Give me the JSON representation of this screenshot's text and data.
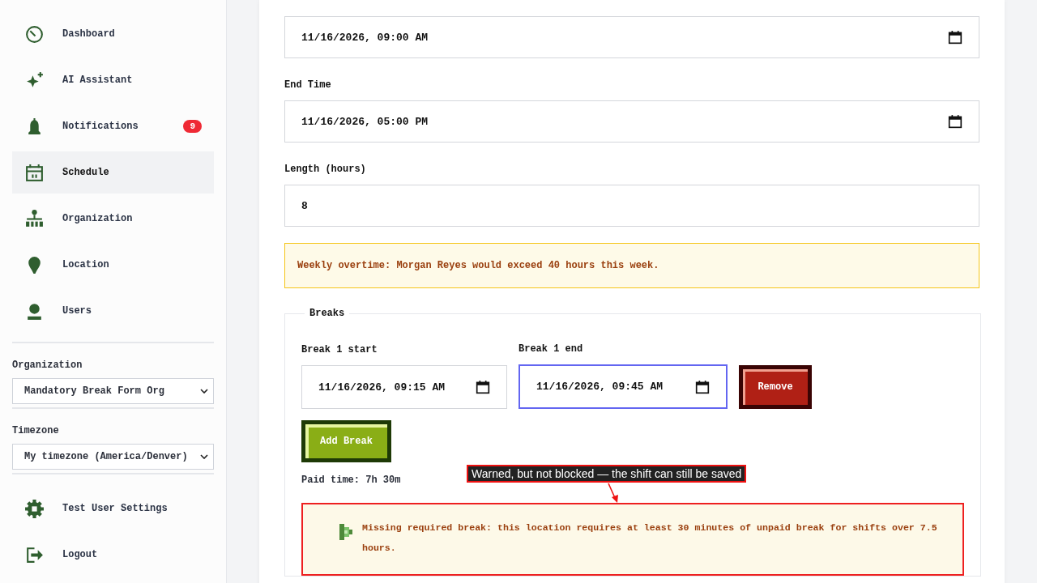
{
  "sidebar": {
    "items": [
      {
        "label": "Dashboard",
        "kind": "dashboard",
        "selected": false
      },
      {
        "label": "AI Assistant",
        "kind": "sparkle",
        "selected": false
      },
      {
        "label": "Notifications",
        "kind": "bell",
        "selected": false,
        "badge": "9"
      },
      {
        "label": "Schedule",
        "kind": "calendar",
        "selected": true
      },
      {
        "label": "Organization",
        "kind": "org",
        "selected": false
      },
      {
        "label": "Location",
        "kind": "pin",
        "selected": false
      },
      {
        "label": "Users",
        "kind": "user",
        "selected": false
      }
    ],
    "selects": [
      {
        "label": "Organization",
        "value": "Mandatory Break Form Org"
      },
      {
        "label": "Timezone",
        "value": "My timezone (America/Denver)"
      }
    ],
    "footer_items": [
      {
        "label": "Test User Settings",
        "kind": "gear"
      },
      {
        "label": "Logout",
        "kind": "logout"
      }
    ]
  },
  "form": {
    "start_time": {
      "value": "11/16/2026, 09:00 AM"
    },
    "end_time": {
      "label": "End Time",
      "value": "11/16/2026, 05:00 PM"
    },
    "length": {
      "label": "Length (hours)",
      "value": "8"
    },
    "overtime_warning": "Weekly overtime: Morgan Reyes would exceed 40 hours this week.",
    "breaks": {
      "legend": "Breaks",
      "rows": [
        {
          "start_label": "Break 1 start",
          "start_value": "11/16/2026, 09:15 AM",
          "end_label": "Break 1 end",
          "end_value": "11/16/2026, 09:45 AM",
          "end_focused": true,
          "remove_label": "Remove"
        }
      ],
      "add_label": "Add Break",
      "paid_time": "Paid time: 7h 30m",
      "annotation": "Warned, but not blocked — the shift can still be saved",
      "break_warning": "Missing required break: this location requires at least 30 minutes of unpaid break for shifts over 7.5 hours."
    }
  }
}
